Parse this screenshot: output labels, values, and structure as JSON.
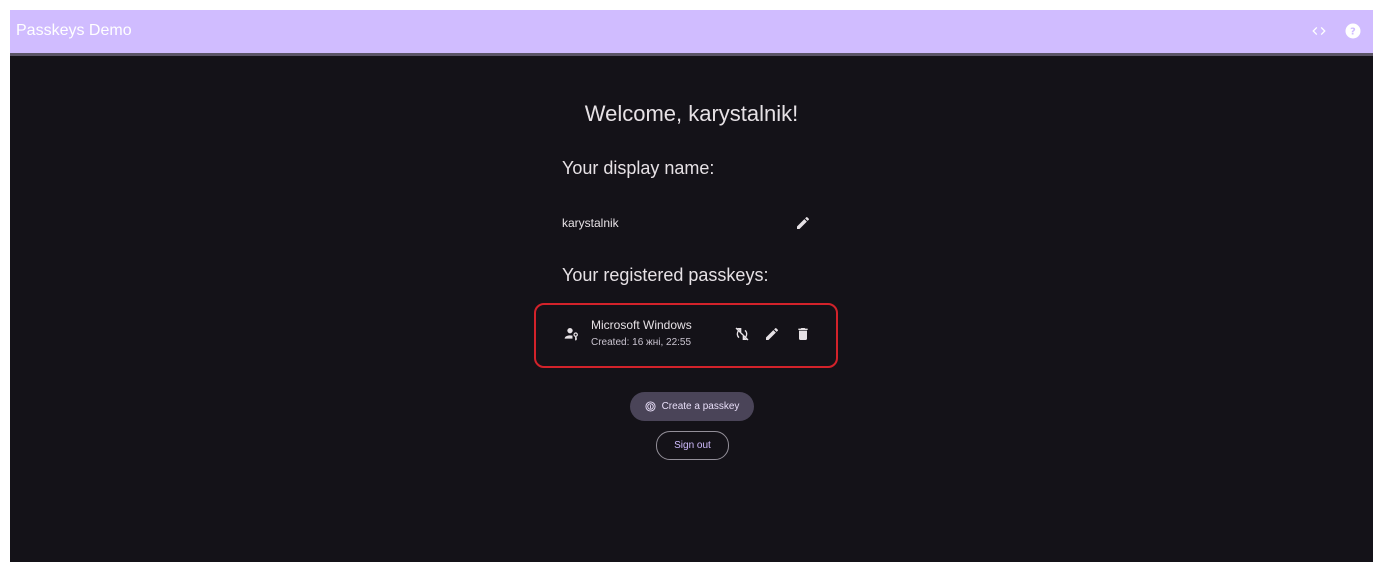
{
  "app": {
    "title": "Passkeys Demo",
    "accent_color": "#d0bcff",
    "background_color": "#141218",
    "icons": [
      "code-icon",
      "help-icon"
    ]
  },
  "main": {
    "welcome": "Welcome, karystalnik!",
    "display_name_label": "Your display name:",
    "display_name_value": "karystalnik",
    "passkeys_label": "Your registered passkeys:",
    "passkeys": [
      {
        "name": "Microsoft Windows",
        "created": "Created: 16 жні, 22:55",
        "icons": [
          "passkey-user-icon",
          "sync-disabled-icon",
          "edit-icon",
          "delete-icon"
        ]
      }
    ],
    "highlight_color": "#d3222a",
    "create_button_label": "Create a passkey",
    "signout_button_label": "Sign out"
  }
}
